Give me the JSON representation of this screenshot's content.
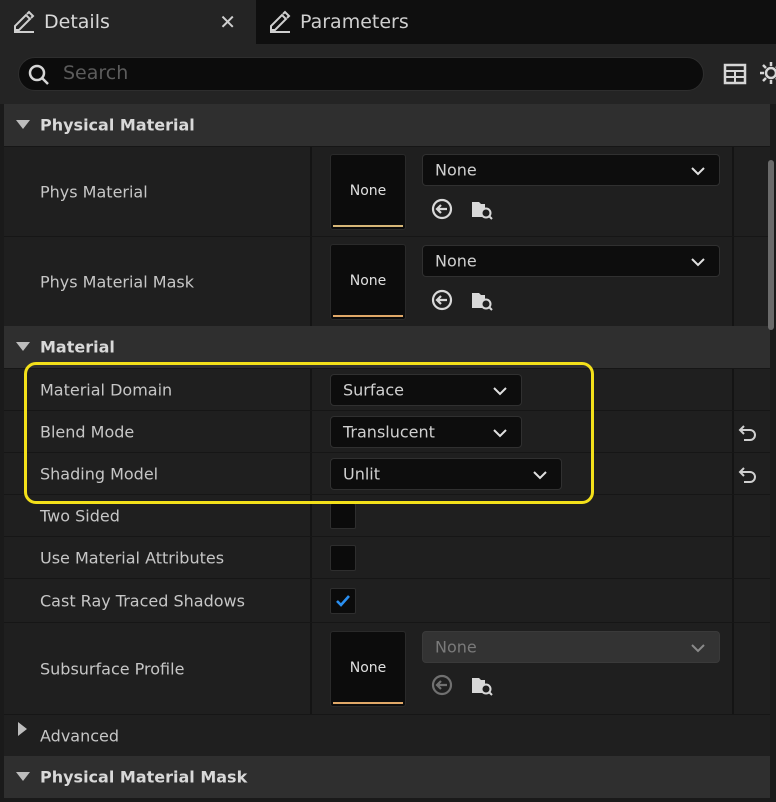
{
  "tabs": {
    "details": {
      "label": "Details",
      "icon": "edit-icon"
    },
    "close": "✕",
    "parameters": {
      "label": "Parameters",
      "icon": "edit-icon"
    }
  },
  "search": {
    "placeholder": "Search"
  },
  "sections": {
    "physical_material": "Physical Material",
    "material": "Material",
    "advanced": "Advanced",
    "physical_material_mask": "Physical Material Mask"
  },
  "properties": {
    "phys_material": {
      "label": "Phys Material",
      "thumb": "None",
      "value": "None"
    },
    "phys_material_mask": {
      "label": "Phys Material Mask",
      "thumb": "None",
      "value": "None"
    },
    "material_domain": {
      "label": "Material Domain",
      "value": "Surface"
    },
    "blend_mode": {
      "label": "Blend Mode",
      "value": "Translucent"
    },
    "shading_model": {
      "label": "Shading Model",
      "value": "Unlit"
    },
    "two_sided": {
      "label": "Two Sided",
      "checked": false
    },
    "use_material_attributes": {
      "label": "Use Material Attributes",
      "checked": false
    },
    "cast_ray_traced_shadows": {
      "label": "Cast Ray Traced Shadows",
      "checked": true
    },
    "subsurface_profile": {
      "label": "Subsurface Profile",
      "thumb": "None",
      "value": "None"
    }
  },
  "colors": {
    "highlight": "#f3e01a",
    "check": "#2a8ff0",
    "thumb_bar": "#d6b677"
  }
}
